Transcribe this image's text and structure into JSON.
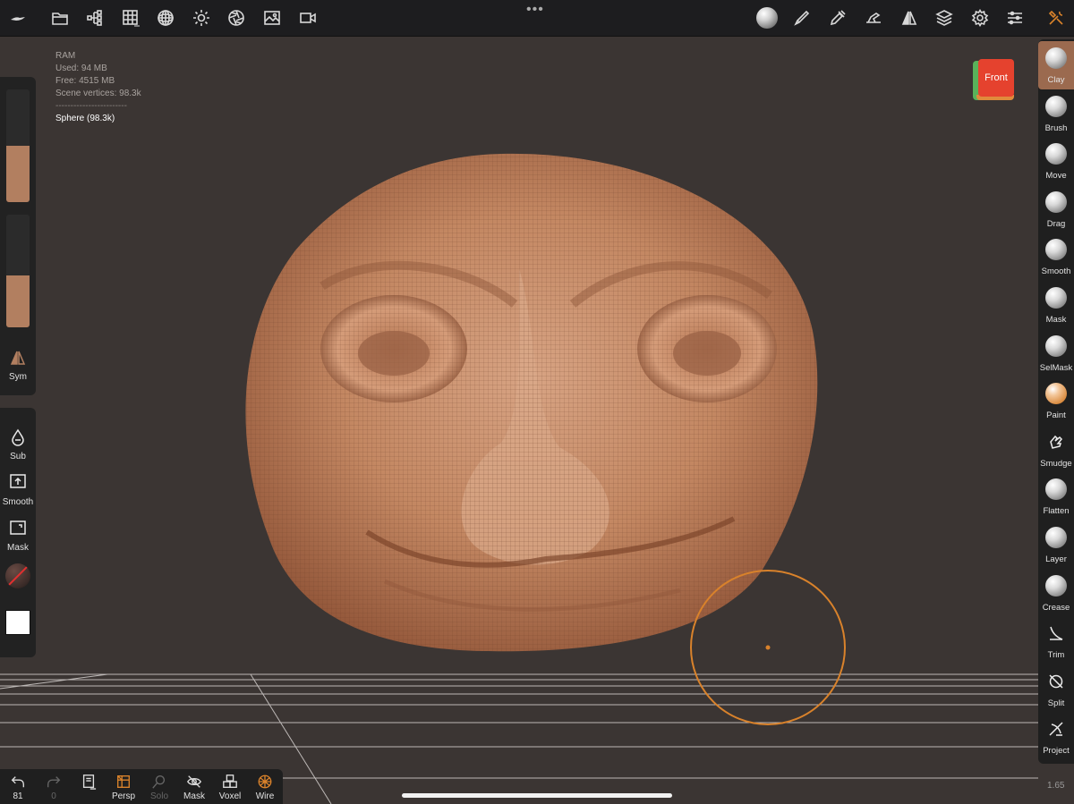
{
  "topbar": {
    "left_icons": [
      "nomad-logo-icon",
      "folder-icon",
      "scene-tree-icon",
      "topology-grid-icon",
      "material-sphere-icon",
      "light-sun-icon",
      "shading-aperture-icon",
      "background-image-icon",
      "camera-video-icon"
    ],
    "right_icons": [
      "material-preview-icon",
      "paint-brush-icon",
      "stroke-pen-icon",
      "pressure-hand-icon",
      "symmetry-icon",
      "layers-icon",
      "settings-gear-icon",
      "sliders-icon",
      "tools-icon"
    ],
    "menu_dots": "•••"
  },
  "stats": {
    "ram_label": "RAM",
    "used": "Used: 94 MB",
    "free": "Free: 4515 MB",
    "vertices": "Scene vertices: 98.3k",
    "separator": "------------------------",
    "object": "Sphere (98.3k)"
  },
  "left_panel": {
    "radius_level": 0.5,
    "intensity_level": 0.46,
    "slider_color": "#b27f60",
    "sym_label": "Sym",
    "sub_label": "Sub",
    "smooth_label": "Smooth",
    "mask_label": "Mask"
  },
  "view_cube": {
    "label": "Front"
  },
  "tools": [
    {
      "label": "Clay",
      "icon": "clay-ball-icon",
      "active": true
    },
    {
      "label": "Brush",
      "icon": "brush-ball-icon"
    },
    {
      "label": "Move",
      "icon": "move-ball-icon"
    },
    {
      "label": "Drag",
      "icon": "drag-ball-icon"
    },
    {
      "label": "Smooth",
      "icon": "smooth-ball-icon"
    },
    {
      "label": "Mask",
      "icon": "mask-ball-icon"
    },
    {
      "label": "SelMask",
      "icon": "selmask-ball-icon"
    },
    {
      "label": "Paint",
      "icon": "paint-ball-icon"
    },
    {
      "label": "Smudge",
      "icon": "smudge-finger-icon"
    },
    {
      "label": "Flatten",
      "icon": "flatten-ball-icon"
    },
    {
      "label": "Layer",
      "icon": "layer-ball-icon"
    },
    {
      "label": "Crease",
      "icon": "crease-ball-icon"
    },
    {
      "label": "Trim",
      "icon": "trim-icon"
    },
    {
      "label": "Split",
      "icon": "split-icon"
    },
    {
      "label": "Project",
      "icon": "project-icon"
    }
  ],
  "bottom_bar": {
    "undo_count": "81",
    "redo_count": "0",
    "persp_label": "Persp",
    "solo_label": "Solo",
    "mask_label": "Mask",
    "voxel_label": "Voxel",
    "wire_label": "Wire"
  },
  "version": "1.65",
  "colors": {
    "accent": "#9b6a4f",
    "mesh": "#c08562",
    "cursor": "#d9822b",
    "viewport_bg": "#3b3533"
  }
}
